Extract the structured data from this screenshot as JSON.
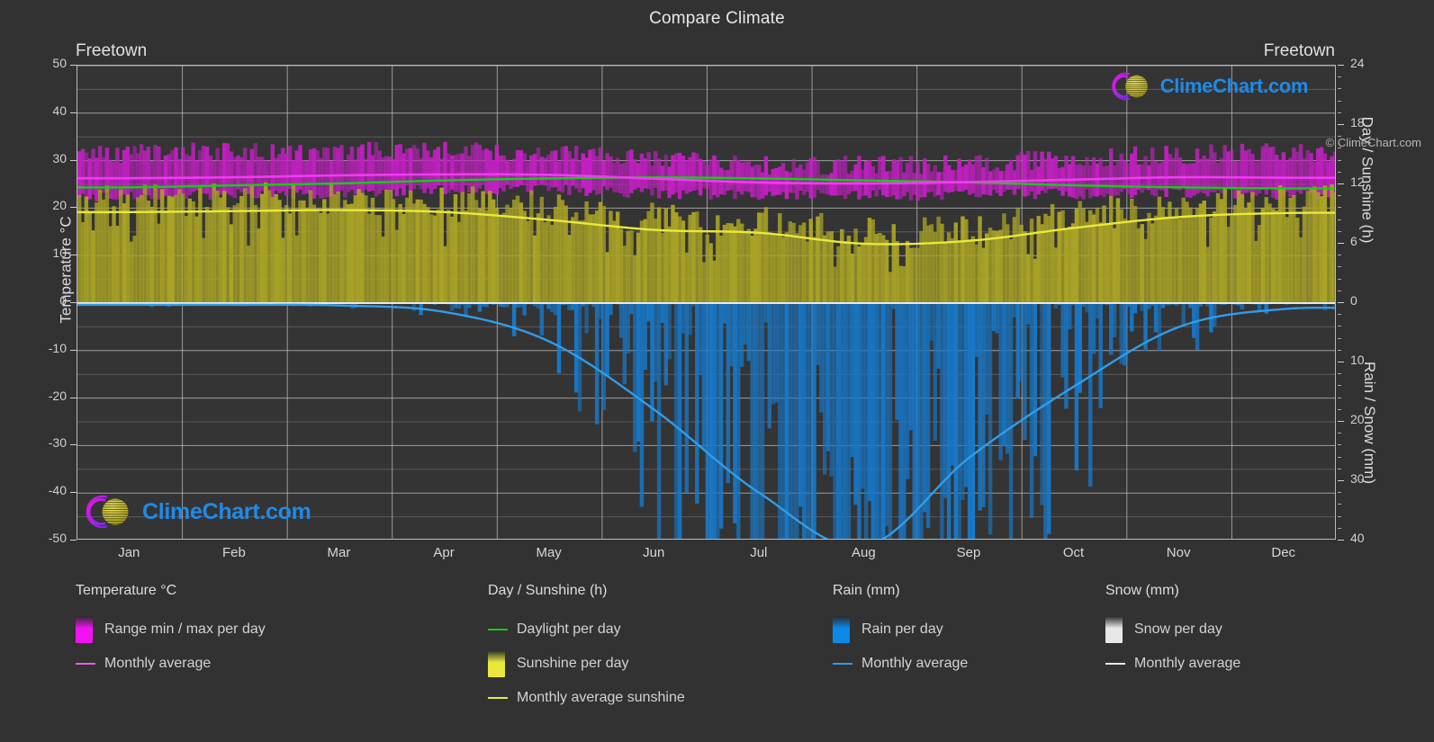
{
  "header": {
    "title": "Compare Climate",
    "left_location": "Freetown",
    "right_location": "Freetown"
  },
  "branding": {
    "logo_text": "ClimeChart.com",
    "copyright": "© ClimeChart.com",
    "logo_text_color": "#1f8ae8",
    "logo_arc_color": "#c21fd6",
    "logo_sphere_color": "#d4cc28"
  },
  "axes": {
    "left_title": "Temperature °C",
    "left_ticks": [
      "50",
      "40",
      "30",
      "20",
      "10",
      "0",
      "-10",
      "-20",
      "-30",
      "-40",
      "-50"
    ],
    "right_top_title": "Day / Sunshine (h)",
    "right_top_ticks": [
      "24",
      "18",
      "12",
      "6",
      "0"
    ],
    "right_bottom_title": "Rain / Snow (mm)",
    "right_bottom_ticks": [
      "0",
      "10",
      "20",
      "30",
      "40"
    ],
    "months": [
      "Jan",
      "Feb",
      "Mar",
      "Apr",
      "May",
      "Jun",
      "Jul",
      "Aug",
      "Sep",
      "Oct",
      "Nov",
      "Dec"
    ]
  },
  "legend": {
    "groups": [
      {
        "heading": "Temperature °C",
        "items": [
          {
            "label": "Range min / max per day",
            "marker": "box",
            "color": "#ef13ef"
          },
          {
            "label": "Monthly average",
            "marker": "line",
            "color": "#e45fe0"
          }
        ]
      },
      {
        "heading": "Day / Sunshine (h)",
        "items": [
          {
            "label": "Daylight per day",
            "marker": "line",
            "color": "#12cf12"
          },
          {
            "label": "Sunshine per day",
            "marker": "box",
            "color": "#e8e93c"
          },
          {
            "label": "Monthly average sunshine",
            "marker": "line",
            "color": "#e9e93c"
          }
        ]
      },
      {
        "heading": "Rain (mm)",
        "items": [
          {
            "label": "Rain per day",
            "marker": "box",
            "color": "#0b8ae8"
          },
          {
            "label": "Monthly average",
            "marker": "line",
            "color": "#2f9de8"
          }
        ]
      },
      {
        "heading": "Snow (mm)",
        "items": [
          {
            "label": "Snow per day",
            "marker": "box",
            "color": "#e8e8e8"
          },
          {
            "label": "Monthly average",
            "marker": "line",
            "color": "#e8e8e8"
          }
        ]
      }
    ]
  },
  "chart_data": {
    "type": "area",
    "title": "Compare Climate",
    "subtitle": "Freetown",
    "xlabel": "",
    "ylabel": "Temperature °C",
    "ylim": [
      -50,
      50
    ],
    "grid": true,
    "legend_position": "bottom",
    "x": [
      "Jan",
      "Feb",
      "Mar",
      "Apr",
      "May",
      "Jun",
      "Jul",
      "Aug",
      "Sep",
      "Oct",
      "Nov",
      "Dec"
    ],
    "right_axis_top": {
      "label": "Day / Sunshine (h)",
      "range": [
        0,
        24
      ]
    },
    "right_axis_bottom": {
      "label": "Rain / Snow (mm)",
      "range": [
        0,
        40
      ]
    },
    "series": [
      {
        "name": "Temperature monthly average",
        "units": "°C",
        "color": "#ef3cef",
        "values": [
          26.3,
          26.5,
          26.9,
          27.1,
          27.0,
          26.2,
          25.4,
          25.2,
          25.5,
          26.0,
          26.5,
          26.4
        ]
      },
      {
        "name": "Temperature range max per day",
        "units": "°C",
        "color": "#cc22cc",
        "values": [
          31.0,
          31.2,
          31.3,
          31.3,
          30.8,
          29.6,
          28.6,
          28.4,
          29.0,
          29.8,
          30.6,
          31.0
        ]
      },
      {
        "name": "Temperature range min per day",
        "units": "°C",
        "color": "#cc22cc",
        "values": [
          22.4,
          22.8,
          23.3,
          23.8,
          23.8,
          23.2,
          22.8,
          22.7,
          22.8,
          23.0,
          23.2,
          22.8
        ]
      },
      {
        "name": "Daylight per day",
        "units": "h",
        "color": "#12cf12",
        "values": [
          11.7,
          11.9,
          12.1,
          12.4,
          12.6,
          12.7,
          12.6,
          12.4,
          12.2,
          11.9,
          11.7,
          11.6
        ]
      },
      {
        "name": "Monthly average sunshine",
        "units": "h",
        "color": "#e9e93c",
        "values": [
          9.2,
          9.3,
          9.4,
          9.2,
          8.4,
          7.4,
          7.1,
          6.0,
          6.3,
          7.6,
          8.7,
          9.1
        ]
      },
      {
        "name": "Rain monthly average",
        "units": "mm",
        "color": "#2f9de8",
        "values": [
          0.3,
          0.3,
          0.4,
          1.5,
          6.5,
          18.0,
          32.0,
          41.0,
          26.0,
          14.0,
          4.0,
          1.0
        ]
      },
      {
        "name": "Snow monthly average",
        "units": "mm",
        "color": "#e8e8e8",
        "values": [
          0,
          0,
          0,
          0,
          0,
          0,
          0,
          0,
          0,
          0,
          0,
          0
        ]
      }
    ]
  }
}
